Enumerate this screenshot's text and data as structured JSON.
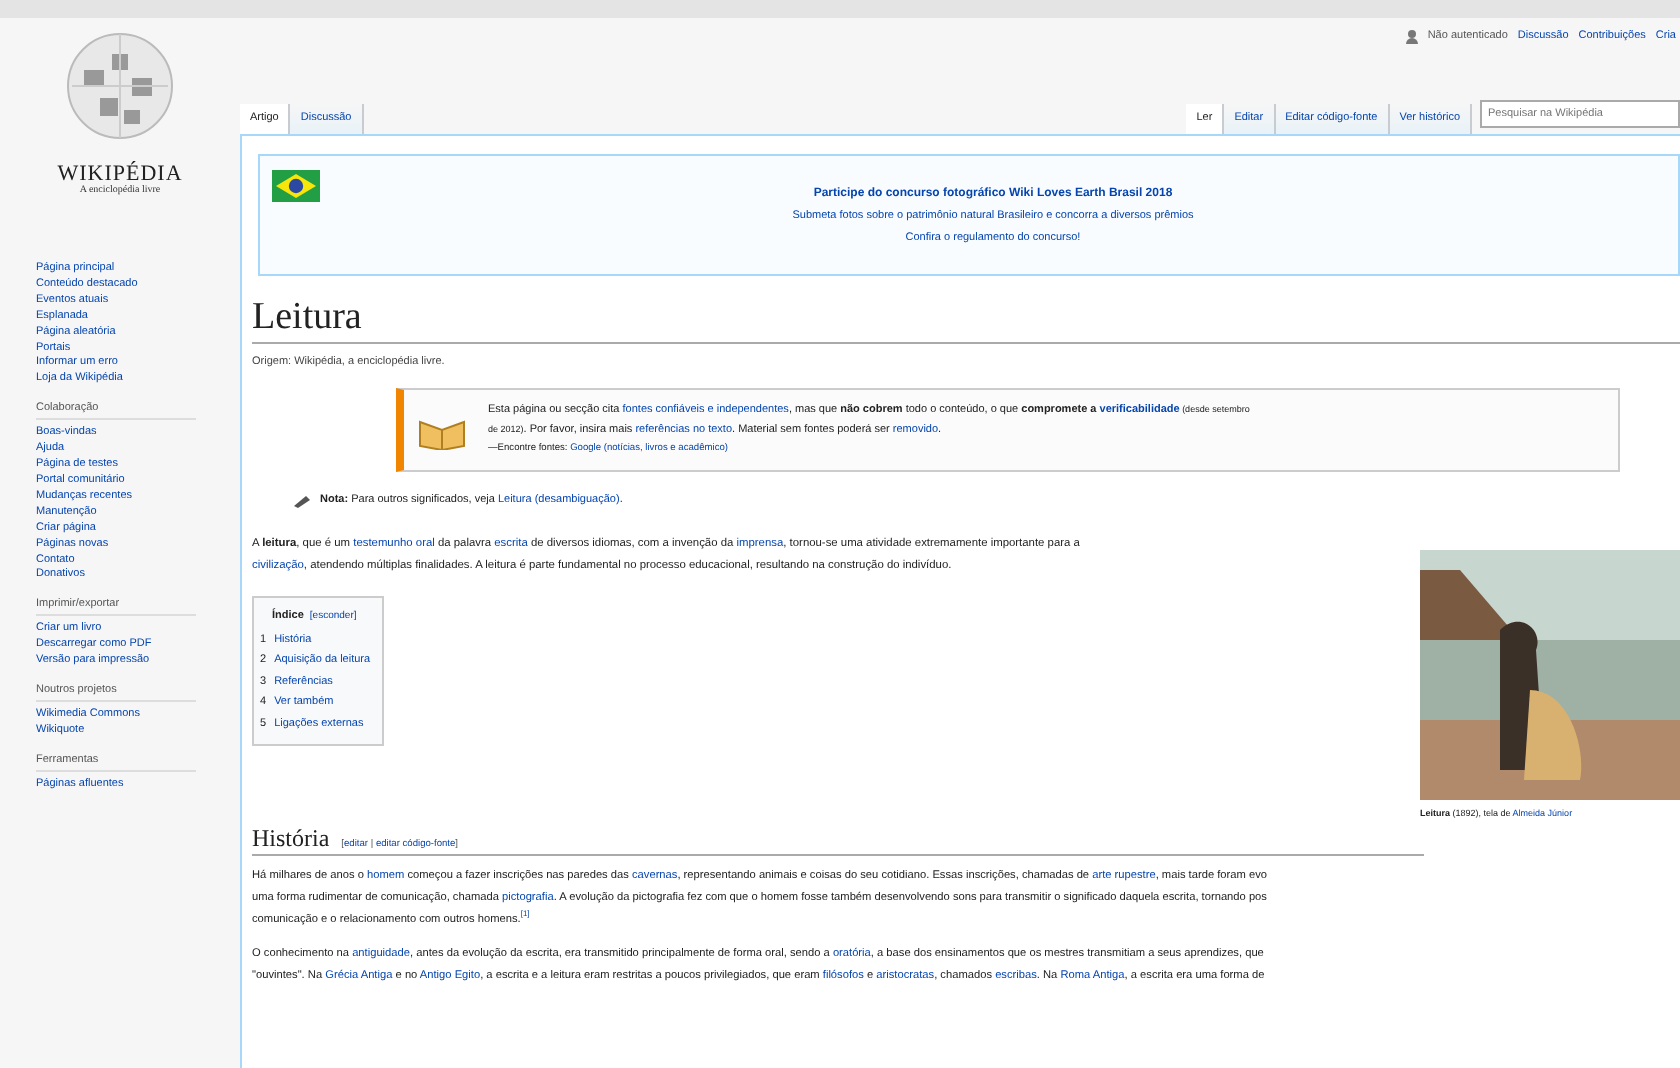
{
  "logo": {
    "wordmark": "WIKIPÉDIA",
    "tagline": "A enciclopédia livre"
  },
  "sidebar": [
    {
      "items": [
        "Página principal",
        "Conteúdo destacado",
        "Eventos atuais",
        "Esplanada",
        "Página aleatória",
        "Portais",
        "Informar um erro",
        "Loja da Wikipédia"
      ]
    },
    {
      "heading": "Colaboração",
      "items": [
        "Boas-vindas",
        "Ajuda",
        "Página de testes",
        "Portal comunitário",
        "Mudanças recentes",
        "Manutenção",
        "Criar página",
        "Páginas novas",
        "Contato",
        "Donativos"
      ]
    },
    {
      "heading": "Imprimir/exportar",
      "items": [
        "Criar um livro",
        "Descarregar como PDF",
        "Versão para impressão"
      ]
    },
    {
      "heading": "Noutros projetos",
      "items": [
        "Wikimedia Commons",
        "Wikiquote"
      ]
    },
    {
      "heading": "Ferramentas",
      "items": [
        "Páginas afluentes"
      ]
    }
  ],
  "personal_tools": {
    "status": "Não autenticado",
    "links": [
      "Discussão",
      "Contribuições",
      "Cria"
    ]
  },
  "namespace_tabs": [
    {
      "label": "Artigo",
      "selected": true
    },
    {
      "label": "Discussão",
      "selected": false
    }
  ],
  "view_tabs": [
    {
      "label": "Ler",
      "selected": true
    },
    {
      "label": "Editar",
      "selected": false
    },
    {
      "label": "Editar código-fonte",
      "selected": false
    },
    {
      "label": "Ver histórico",
      "selected": false
    }
  ],
  "search": {
    "placeholder": "Pesquisar na Wikipédia"
  },
  "banner": {
    "title": "Participe do concurso fotográfico Wiki Loves Earth Brasil 2018",
    "subtitle": "Submeta fotos sobre o patrimônio natural Brasileiro e concorra a diversos prêmios",
    "link": "Confira o regulamento do concurso!"
  },
  "page_title": "Leitura",
  "tagline": "Origem: Wikipédia, a enciclopédia livre.",
  "notice": {
    "lines": [
      [
        {
          "text": "Esta página ou secção cita ",
          "kind": "text"
        },
        {
          "text": "fontes confiáveis e independentes",
          "kind": "link"
        },
        {
          "text": ", mas que ",
          "kind": "text"
        },
        {
          "text": "não cobrem",
          "kind": "bold"
        },
        {
          "text": " todo o conteúdo, o que ",
          "kind": "text"
        },
        {
          "text": "compromete a ",
          "kind": "bold"
        },
        {
          "text": "verificabilidade",
          "kind": "bold-link"
        },
        {
          "text": " (desde setembro",
          "kind": "small"
        }
      ],
      [
        {
          "text": "de 2012)",
          "kind": "small"
        },
        {
          "text": ". Por favor, insira mais ",
          "kind": "text"
        },
        {
          "text": "referências no texto",
          "kind": "link"
        },
        {
          "text": ". Material sem fontes poderá ser ",
          "kind": "text"
        },
        {
          "text": "removido",
          "kind": "link"
        },
        {
          "text": ".",
          "kind": "text"
        }
      ]
    ],
    "source": [
      [
        {
          "text": "—Encontre fontes: ",
          "kind": "text"
        },
        {
          "text": "Google (notícias, livros e acadêmico)",
          "kind": "link"
        }
      ]
    ]
  },
  "hatnote": [
    [
      {
        "text": "Nota:",
        "kind": "bold"
      },
      {
        "text": " Para outros significados, veja ",
        "kind": "text"
      },
      {
        "text": "Leitura (desambiguação)",
        "kind": "link"
      },
      {
        "text": ".",
        "kind": "text"
      }
    ]
  ],
  "lead": [
    [
      {
        "text": "A ",
        "kind": "text"
      },
      {
        "text": "leitura",
        "kind": "bold"
      },
      {
        "text": ", que é um ",
        "kind": "text"
      },
      {
        "text": "testemunho oral",
        "kind": "link"
      },
      {
        "text": " da palavra ",
        "kind": "text"
      },
      {
        "text": "escrita",
        "kind": "link"
      },
      {
        "text": " de diversos idiomas, com a invenção da ",
        "kind": "text"
      },
      {
        "text": "imprensa",
        "kind": "link"
      },
      {
        "text": ", tornou-se uma atividade extremamente importante para a",
        "kind": "text"
      }
    ],
    [
      {
        "text": "civilização",
        "kind": "link"
      },
      {
        "text": ", atendendo múltiplas finalidades. A leitura é parte fundamental no processo educacional, resultando na construção do indivíduo.",
        "kind": "text"
      }
    ]
  ],
  "toc": {
    "title": "Índice",
    "toggle": "[esconder]",
    "items": [
      {
        "number": "1",
        "label": "História"
      },
      {
        "number": "2",
        "label": "Aquisição da leitura"
      },
      {
        "number": "3",
        "label": "Referências"
      },
      {
        "number": "4",
        "label": "Ver também"
      },
      {
        "number": "5",
        "label": "Ligações externas"
      }
    ]
  },
  "figure": {
    "caption": [
      [
        {
          "text": "Leitura",
          "kind": "bold"
        },
        {
          "text": " (1892), tela de ",
          "kind": "text"
        },
        {
          "text": "Almeida Júnior",
          "kind": "link"
        }
      ]
    ]
  },
  "section": {
    "heading": "História",
    "edit_links": [
      [
        {
          "text": "[",
          "kind": "text"
        },
        {
          "text": "editar",
          "kind": "link"
        },
        {
          "text": " | ",
          "kind": "text"
        },
        {
          "text": "editar código-fonte",
          "kind": "link"
        },
        {
          "text": "]",
          "kind": "text"
        }
      ]
    ],
    "paragraphs": [
      [
        [
          {
            "text": "Há milhares de anos o ",
            "kind": "text"
          },
          {
            "text": "homem",
            "kind": "link"
          },
          {
            "text": " começou a fazer inscrições nas paredes das ",
            "kind": "text"
          },
          {
            "text": "cavernas",
            "kind": "link"
          },
          {
            "text": ", representando animais e coisas do seu cotidiano. Essas inscrições, chamadas de ",
            "kind": "text"
          },
          {
            "text": "arte rupestre",
            "kind": "link"
          },
          {
            "text": ", mais tarde foram evo",
            "kind": "text"
          }
        ],
        [
          {
            "text": "uma forma rudimentar de comunicação, chamada ",
            "kind": "text"
          },
          {
            "text": "pictografia",
            "kind": "link"
          },
          {
            "text": ". A evolução da pictografia fez com que o homem fosse também desenvolvendo sons para transmitir o significado daquela escrita, tornando pos",
            "kind": "text"
          }
        ],
        [
          {
            "text": "comunicação e o relacionamento com outros homens.",
            "kind": "text"
          },
          {
            "text": "[1]",
            "kind": "sup"
          }
        ]
      ],
      [
        [
          {
            "text": "O conhecimento na ",
            "kind": "text"
          },
          {
            "text": "antiguidade",
            "kind": "link"
          },
          {
            "text": ", antes da evolução da escrita, era transmitido principalmente de forma oral, sendo a ",
            "kind": "text"
          },
          {
            "text": "oratória",
            "kind": "link"
          },
          {
            "text": ", a base dos ensinamentos que os mestres transmitiam a seus aprendizes, que",
            "kind": "text"
          }
        ],
        [
          {
            "text": "\"ouvintes\". Na ",
            "kind": "text"
          },
          {
            "text": "Grécia Antiga",
            "kind": "link"
          },
          {
            "text": " e no ",
            "kind": "text"
          },
          {
            "text": "Antigo Egito",
            "kind": "link"
          },
          {
            "text": ", a escrita e a leitura eram restritas a poucos privilegiados, que eram ",
            "kind": "text"
          },
          {
            "text": "filósofos",
            "kind": "link"
          },
          {
            "text": " e ",
            "kind": "text"
          },
          {
            "text": "aristocratas",
            "kind": "link"
          },
          {
            "text": ", chamados ",
            "kind": "text"
          },
          {
            "text": "escribas",
            "kind": "link"
          },
          {
            "text": ". Na ",
            "kind": "text"
          },
          {
            "text": "Roma Antiga",
            "kind": "link"
          },
          {
            "text": ", a escrita era uma forma de",
            "kind": "text"
          }
        ]
      ]
    ]
  }
}
